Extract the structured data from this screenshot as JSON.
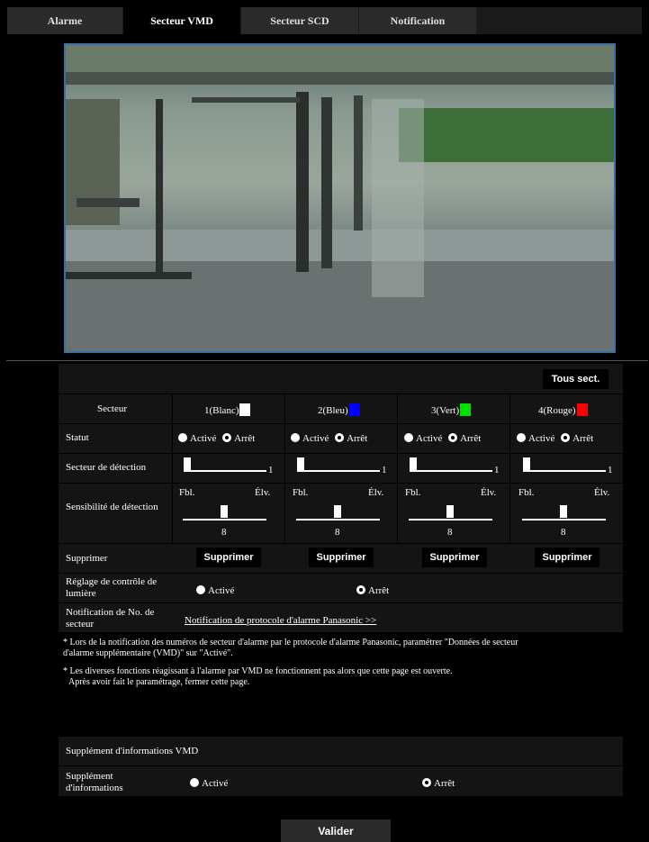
{
  "tabs": [
    {
      "label": "Alarme"
    },
    {
      "label": "Secteur VMD"
    },
    {
      "label": "Secteur SCD"
    },
    {
      "label": "Notification"
    }
  ],
  "all_sectors_button": "Tous sect.",
  "table": {
    "col_header_label": "Secteur",
    "sectors": [
      {
        "label": "1(Blanc)",
        "color": "#ffffff"
      },
      {
        "label": "2(Bleu)",
        "color": "#0000ff"
      },
      {
        "label": "3(Vert)",
        "color": "#00e000"
      },
      {
        "label": "4(Rouge)",
        "color": "#ff0000"
      }
    ],
    "status_label": "Statut",
    "radio_on": "Activé",
    "radio_off": "Arrêt",
    "detection_area_label": "Secteur de détection",
    "detection_area_value": "1",
    "sensitivity_label": "Sensibilité de détection",
    "sensitivity_low": "Fbl.",
    "sensitivity_high": "Élv.",
    "sensitivity_value": "8",
    "delete_label": "Supprimer",
    "delete_button": "Supprimer",
    "light_control_label": "Réglage de contrôle de lumière",
    "light_on": "Activé",
    "light_off": "Arrêt",
    "area_notif_label": "Notification de No. de secteur",
    "area_notif_link": "Notification de protocole d'alarme Panasonic >>"
  },
  "notes": {
    "note1_line1": "* Lors de la notification des numéros de secteur d'alarme par le protocole d'alarme Panasonic, paramétrer \"Données de secteur",
    "note1_line2": "d'alarme supplémentaire (VMD)\" sur \"Activé\".",
    "note2_line1": "* Les diverses fonctions réagissant à l'alarme par VMD ne fonctionnent pas alors que cette page est ouverte.",
    "note2_line2": "Après avoir fait le paramétrage, fermer cette page."
  },
  "vmd_info": {
    "header": "Supplément d'informations VMD",
    "label": "Supplément d'informations",
    "on": "Activé",
    "off": "Arrêt"
  },
  "submit_button": "Valider"
}
